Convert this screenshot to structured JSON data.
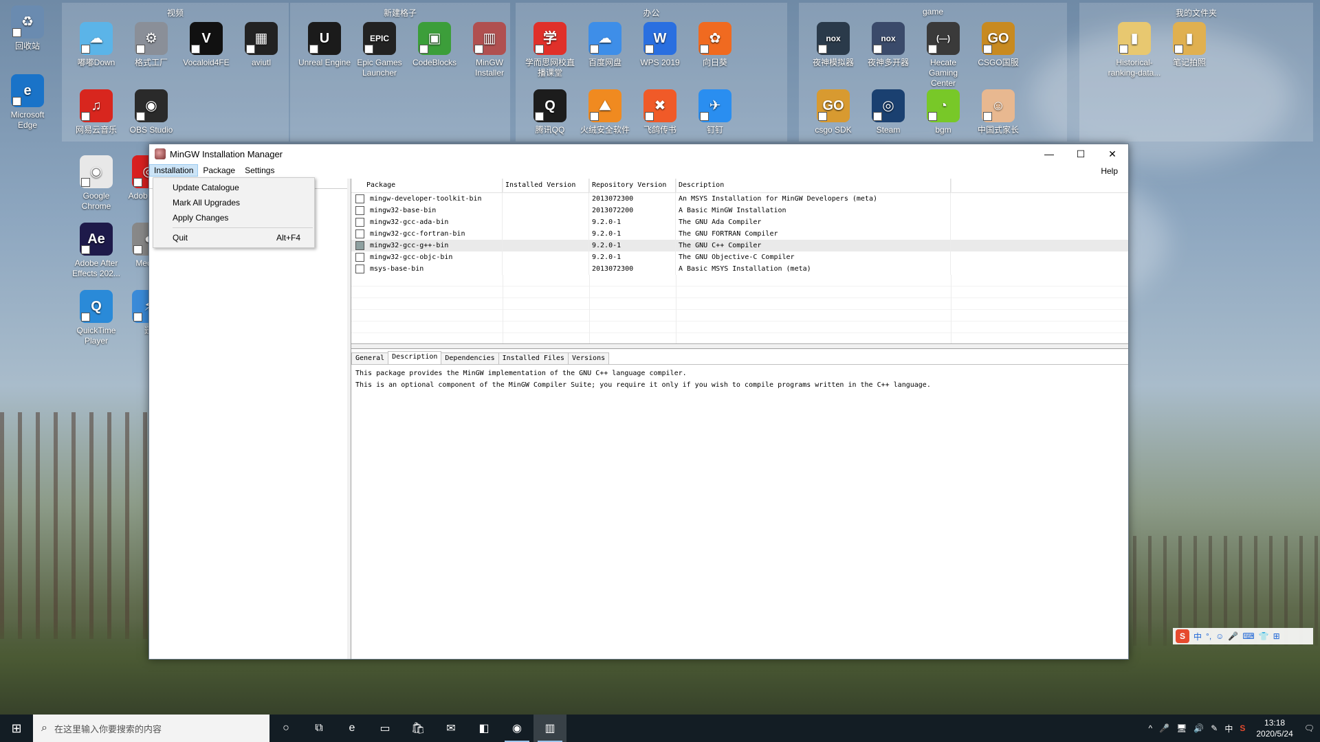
{
  "desktop": {
    "left_icons": [
      {
        "label": "回收站",
        "color": "#6a8bb0",
        "glyph": "♻"
      },
      {
        "label": "Microsoft Edge",
        "color": "#1a73c8",
        "glyph": "e"
      }
    ],
    "groups": [
      {
        "title": "视频",
        "icons": [
          {
            "label": "嘟嘟Down",
            "color": "#5bb4e8",
            "glyph": "☁"
          },
          {
            "label": "格式工厂",
            "color": "#8a8f98",
            "glyph": "⚙"
          },
          {
            "label": "Vocaloid4FE",
            "color": "#111111",
            "glyph": "V"
          },
          {
            "label": "aviutl",
            "color": "#222222",
            "glyph": "▦"
          },
          {
            "label": "网易云音乐",
            "color": "#d8261e",
            "glyph": "♫"
          },
          {
            "label": "OBS Studio",
            "color": "#2a2a2a",
            "glyph": "◉"
          }
        ]
      },
      {
        "title": "新建格子",
        "icons": [
          {
            "label": "Unreal Engine",
            "color": "#1b1b1b",
            "glyph": "U"
          },
          {
            "label": "Epic Games Launcher",
            "color": "#222222",
            "glyph": "EPIC"
          },
          {
            "label": "CodeBlocks",
            "color": "#3c9e3a",
            "glyph": "▣"
          },
          {
            "label": "MinGW Installer",
            "color": "#b05050",
            "glyph": "▥"
          }
        ]
      },
      {
        "title": "办公",
        "icons": [
          {
            "label": "学而思网校直播课堂",
            "color": "#e0302a",
            "glyph": "学"
          },
          {
            "label": "百度网盘",
            "color": "#3e8ee8",
            "glyph": "☁"
          },
          {
            "label": "WPS 2019",
            "color": "#2a6fe0",
            "glyph": "W"
          },
          {
            "label": "向日葵",
            "color": "#f06a20",
            "glyph": "✿"
          },
          {
            "label": "腾讯QQ",
            "color": "#1c1c1c",
            "glyph": "Q"
          },
          {
            "label": "火绒安全软件",
            "color": "#f08a20",
            "glyph": "⛰"
          },
          {
            "label": "飞鸽传书",
            "color": "#f05a28",
            "glyph": "✖"
          },
          {
            "label": "钉钉",
            "color": "#2a8ef0",
            "glyph": "✈"
          }
        ]
      },
      {
        "title": "game",
        "icons": [
          {
            "label": "夜神模拟器",
            "color": "#2a3a4a",
            "glyph": "nox"
          },
          {
            "label": "夜神多开器",
            "color": "#3a4a6a",
            "glyph": "nox"
          },
          {
            "label": "Hecate Gaming Center",
            "color": "#3a3a3a",
            "glyph": "(—)"
          },
          {
            "label": "CSGO国服",
            "color": "#c88a20",
            "glyph": "GO"
          },
          {
            "label": "csgo SDK",
            "color": "#d89a30",
            "glyph": "GO"
          },
          {
            "label": "Steam",
            "color": "#1a4070",
            "glyph": "◎"
          },
          {
            "label": "bgm",
            "color": "#78c828",
            "glyph": "◔"
          },
          {
            "label": "中国式家长",
            "color": "#e8b890",
            "glyph": "☺"
          }
        ]
      },
      {
        "title": "我的文件夹",
        "icons": [
          {
            "label": "Historical-ranking-data...",
            "color": "#e8c870",
            "glyph": "▮"
          },
          {
            "label": "笔记拍照",
            "color": "#e0b050",
            "glyph": "▮"
          }
        ]
      }
    ],
    "column_icons": [
      {
        "label": "Google Chrome",
        "color": "#e8e8e8",
        "glyph": "◉"
      },
      {
        "label": "Adobe After Effects 202...",
        "color": "#1e1a4a",
        "glyph": "Ae"
      },
      {
        "label": "QuickTime Player",
        "color": "#2a8ad8",
        "glyph": "Q"
      }
    ],
    "partial_icons": [
      {
        "label": "Adob ive C",
        "color": "#d82020",
        "glyph": "◎"
      },
      {
        "label": "Medi P",
        "color": "#888888",
        "glyph": "◐"
      },
      {
        "label": "迅",
        "color": "#3a8ad8",
        "glyph": "⚡"
      }
    ]
  },
  "window": {
    "title": "MinGW Installation Manager",
    "controls": {
      "minimize": "—",
      "maximize": "☐",
      "close": "✕"
    },
    "menu": {
      "installation": "Installation",
      "package": "Package",
      "settings": "Settings",
      "help": "Help"
    },
    "dropdown": {
      "update_catalogue": "Update Catalogue",
      "mark_all_upgrades": "Mark All Upgrades",
      "apply_changes": "Apply Changes",
      "quit": "Quit",
      "quit_shortcut": "Alt+F4"
    },
    "table": {
      "headers": [
        "Package",
        "Installed Version",
        "Repository Version",
        "Description"
      ],
      "rows": [
        {
          "pkg": "mingw-developer-toolkit-bin",
          "inst": "",
          "repo": "2013072300",
          "desc": "An MSYS Installation for MinGW Developers (meta)",
          "installed": false,
          "selected": false
        },
        {
          "pkg": "mingw32-base-bin",
          "inst": "",
          "repo": "2013072200",
          "desc": "A Basic MinGW Installation",
          "installed": false,
          "selected": false
        },
        {
          "pkg": "mingw32-gcc-ada-bin",
          "inst": "",
          "repo": "9.2.0-1",
          "desc": "The GNU Ada Compiler",
          "installed": false,
          "selected": false
        },
        {
          "pkg": "mingw32-gcc-fortran-bin",
          "inst": "",
          "repo": "9.2.0-1",
          "desc": "The GNU FORTRAN Compiler",
          "installed": false,
          "selected": false
        },
        {
          "pkg": "mingw32-gcc-g++-bin",
          "inst": "",
          "repo": "9.2.0-1",
          "desc": "The GNU C++ Compiler",
          "installed": true,
          "selected": true
        },
        {
          "pkg": "mingw32-gcc-objc-bin",
          "inst": "",
          "repo": "9.2.0-1",
          "desc": "The GNU Objective-C Compiler",
          "installed": false,
          "selected": false
        },
        {
          "pkg": "msys-base-bin",
          "inst": "",
          "repo": "2013072300",
          "desc": "A Basic MSYS Installation (meta)",
          "installed": false,
          "selected": false
        }
      ]
    },
    "tabs": [
      "General",
      "Description",
      "Dependencies",
      "Installed Files",
      "Versions"
    ],
    "active_tab": "Description",
    "description": [
      "This package provides the MinGW implementation of the GNU C++ language compiler.",
      "This is an optional component of the MinGW Compiler Suite; you require it only if you wish to compile programs written in the C++ language."
    ]
  },
  "ime": {
    "logo": "S",
    "items": [
      "中",
      "°,",
      "☺",
      "🎤",
      "⌨",
      "👕",
      "⊞"
    ]
  },
  "taskbar": {
    "search_placeholder": "在这里输入你要搜索的内容",
    "start_glyph": "⊞",
    "search_glyph": "⌕",
    "buttons": [
      {
        "name": "cortana",
        "glyph": "○"
      },
      {
        "name": "task-view",
        "glyph": "⧉"
      },
      {
        "name": "edge",
        "glyph": "e"
      },
      {
        "name": "file-explorer",
        "glyph": "▭"
      },
      {
        "name": "store",
        "glyph": "🛍"
      },
      {
        "name": "mail",
        "glyph": "✉"
      },
      {
        "name": "visual-studio",
        "glyph": "◧"
      },
      {
        "name": "obs",
        "glyph": "◉"
      },
      {
        "name": "mingw",
        "glyph": "▥"
      }
    ],
    "tray": {
      "chevron": "^",
      "mic": "🎤",
      "network": "🖥",
      "volume": "🔊",
      "pen": "✎",
      "lang": "中",
      "ime": "S",
      "notification": "🗨"
    },
    "time": "13:18",
    "date": "2020/5/24"
  }
}
